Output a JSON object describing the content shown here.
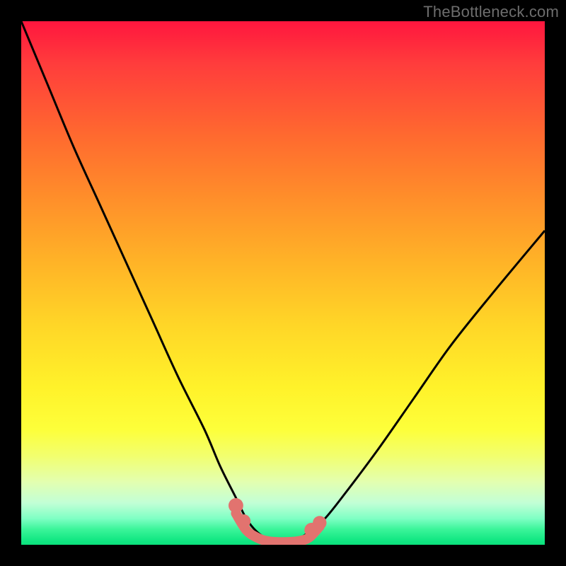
{
  "watermark": "TheBottleneck.com",
  "chart_data": {
    "type": "line",
    "title": "",
    "xlabel": "",
    "ylabel": "",
    "xlim": [
      0,
      100
    ],
    "ylim": [
      0,
      100
    ],
    "background_gradient": {
      "top_color": "#ff163e",
      "bottom_color": "#0be17c"
    },
    "series": [
      {
        "name": "main-curve",
        "color": "#000000",
        "x": [
          0,
          5,
          10,
          15,
          20,
          25,
          30,
          35,
          38,
          41,
          43,
          45,
          47,
          50,
          53,
          55,
          58,
          62,
          68,
          75,
          82,
          90,
          100
        ],
        "y": [
          100,
          88,
          76,
          65,
          54,
          43,
          32,
          22,
          15,
          9,
          5,
          2.5,
          1.2,
          0.6,
          1.2,
          2.5,
          5,
          10,
          18,
          28,
          38,
          48,
          60
        ]
      },
      {
        "name": "flat-bottom-highlight",
        "color": "#e2736f",
        "x": [
          41,
          43,
          45,
          47,
          50,
          53,
          55,
          57
        ],
        "y": [
          6,
          2.8,
          1.4,
          0.7,
          0.5,
          0.7,
          1.4,
          3.5
        ]
      }
    ],
    "markers": [
      {
        "series": "flat-bottom-highlight",
        "x": 41,
        "y": 7.5,
        "r": 1.2
      },
      {
        "series": "flat-bottom-highlight",
        "x": 42.5,
        "y": 4.5,
        "r": 1.0
      },
      {
        "series": "flat-bottom-highlight",
        "x": 55.5,
        "y": 2.8,
        "r": 1.2
      },
      {
        "series": "flat-bottom-highlight",
        "x": 57,
        "y": 4.2,
        "r": 1.0
      }
    ]
  }
}
